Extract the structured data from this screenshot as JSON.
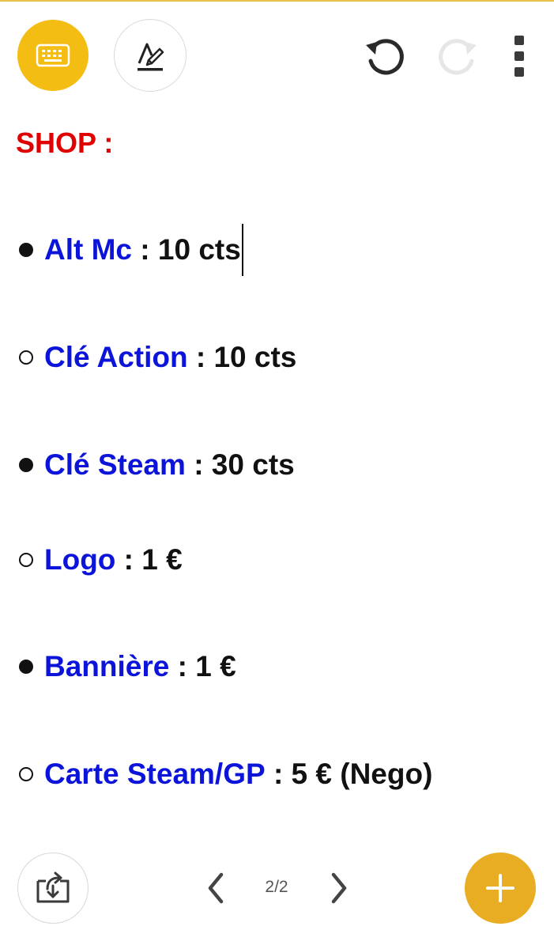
{
  "toolbar": {
    "keyboard_icon": "keyboard-icon",
    "pen_icon": "pen-icon",
    "undo_icon": "undo-icon",
    "redo_icon": "redo-icon",
    "more_icon": "more-vertical-icon"
  },
  "note": {
    "title": "SHOP :",
    "items": [
      {
        "bullet": "filled",
        "name": "Alt Mc",
        "price": " : 10 cts"
      },
      {
        "bullet": "hollow",
        "name": "Clé Action",
        "price": " : 10 cts"
      },
      {
        "bullet": "filled",
        "name": "Clé Steam",
        "price": " : 30 cts"
      },
      {
        "bullet": "hollow",
        "name": "Logo",
        "price": " : 1 €"
      },
      {
        "bullet": "filled",
        "name": "Bannière",
        "price": " : 1 €"
      },
      {
        "bullet": "hollow",
        "name": "Carte Steam/GP",
        "price": " : 5 € (Nego)"
      }
    ]
  },
  "footer": {
    "page_indicator": "2/2",
    "export_icon": "export-icon",
    "prev_icon": "chevron-left-icon",
    "next_icon": "chevron-right-icon",
    "add_icon": "plus-icon"
  },
  "colors": {
    "accent": "#f4bd14",
    "fab": "#e9ad24",
    "title": "#e00000",
    "item_name": "#0b14d8",
    "text": "#111111",
    "disabled_icon": "#e6e6e6"
  }
}
